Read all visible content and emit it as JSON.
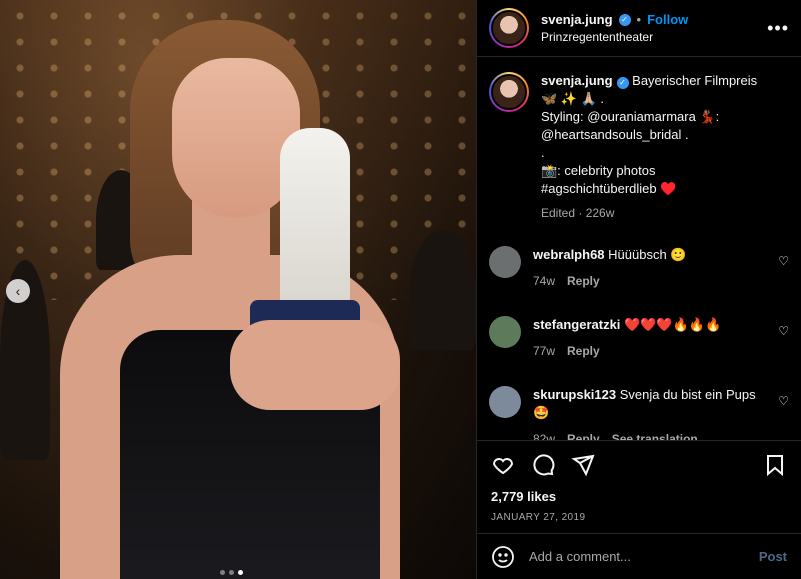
{
  "post": {
    "username": "svenja.jung",
    "follow_label": "Follow",
    "location": "Prinzregententheater",
    "caption": {
      "line1": "Bayerischer Filmpreis",
      "line2": "🦋 ✨ 🙏🏼 .",
      "line3": "Styling: @ouraniamarmara 💃🏽:",
      "line4": "@heartsandsouls_bridal .",
      "line5": ".",
      "line6": "📸: celebrity photos",
      "line7": "#agschichtüberdlieb ♥️"
    },
    "caption_meta": "Edited · 226w",
    "likes": "2,779 likes",
    "date": "JANUARY 27, 2019"
  },
  "comments": [
    {
      "username": "webralph68",
      "text": "Hüüübsch 🙂",
      "age": "74w",
      "reply": "Reply",
      "avatar_color": "#6b6f70"
    },
    {
      "username": "stefangeratzki",
      "text": "❤️❤️❤️🔥🔥🔥",
      "age": "77w",
      "reply": "Reply",
      "avatar_color": "#5d7a5a"
    },
    {
      "username": "skurupski123",
      "text": "Svenja du bist ein Pups 🤩",
      "age": "82w",
      "reply": "Reply",
      "translate": "See translation",
      "avatar_color": "#7c8a9c"
    }
  ],
  "composer": {
    "placeholder": "Add a comment...",
    "post_label": "Post"
  },
  "nav": {
    "prev": "‹"
  },
  "colors": {
    "accent": "#0095f6",
    "verified": "#3897f0",
    "muted": "#a8a8a8"
  }
}
